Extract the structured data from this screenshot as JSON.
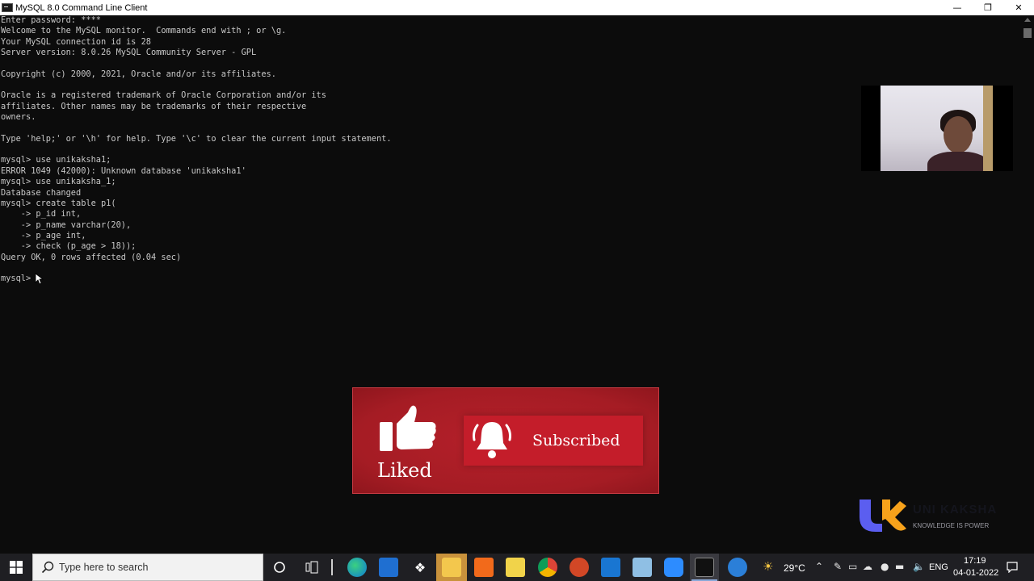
{
  "window": {
    "title": "MySQL 8.0 Command Line Client",
    "minimize_glyph": "—",
    "maximize_glyph": "❐",
    "close_glyph": "✕"
  },
  "console": {
    "text": "Enter password: ****\nWelcome to the MySQL monitor.  Commands end with ; or \\g.\nYour MySQL connection id is 28\nServer version: 8.0.26 MySQL Community Server - GPL\n\nCopyright (c) 2000, 2021, Oracle and/or its affiliates.\n\nOracle is a registered trademark of Oracle Corporation and/or its\naffiliates. Other names may be trademarks of their respective\nowners.\n\nType 'help;' or '\\h' for help. Type '\\c' to clear the current input statement.\n\nmysql> use unikaksha1;\nERROR 1049 (42000): Unknown database 'unikaksha1'\nmysql> use unikaksha_1;\nDatabase changed\nmysql> create table p1(\n    -> p_id int,\n    -> p_name varchar(20),\n    -> p_age int,\n    -> check (p_age > 18));\nQuery OK, 0 rows affected (0.04 sec)\n\nmysql> "
  },
  "overlay": {
    "liked_label": "Liked",
    "subscribed_label": "Subscribed",
    "logo_name": "UNI KAKSHA",
    "logo_tagline": "KNOWLEDGE IS POWER"
  },
  "taskbar": {
    "search_placeholder": "Type here to search",
    "weather_temp": "29°C",
    "language": "ENG",
    "time": "17:19",
    "date": "04-01-2022"
  },
  "colors": {
    "console_bg": "#0c0c0c",
    "console_text": "#c8c8c8",
    "banner_red": "#b5202a",
    "taskbar_bg": "#1f1f23",
    "logo_blue": "#5b5ef0",
    "logo_orange": "#f7a21b"
  },
  "icons": [
    "app-console-icon",
    "minimize-icon",
    "maximize-icon",
    "close-icon",
    "thumbs-up-icon",
    "bell-icon",
    "windows-start-icon",
    "search-icon",
    "cortana-icon",
    "task-view-icon",
    "edge-icon",
    "mail-icon",
    "dropbox-icon",
    "file-explorer-icon",
    "origin-icon",
    "sticky-notes-icon",
    "chrome-icon",
    "powerpoint-icon",
    "snipping-icon",
    "notepad-icon",
    "zoom-icon",
    "mysql-console-icon",
    "help-icon",
    "weather-icon",
    "chevron-up-icon",
    "pen-icon",
    "network-icon",
    "onedrive-icon",
    "microphone-icon",
    "battery-icon",
    "volume-icon",
    "notification-icon"
  ]
}
